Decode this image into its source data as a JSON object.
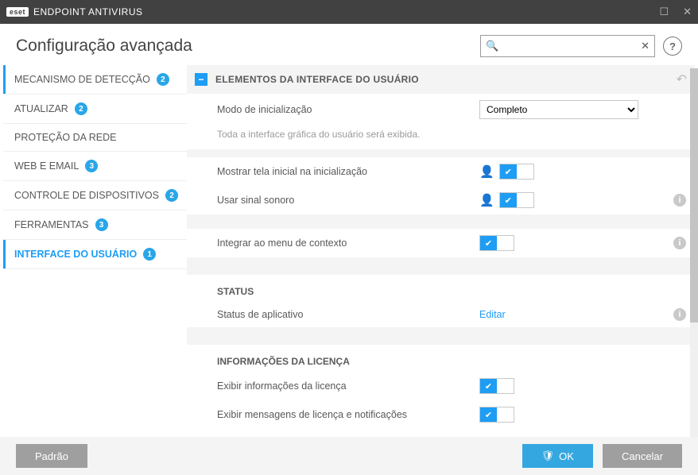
{
  "titlebar": {
    "brand_logo": "eset",
    "brand_text": "ENDPOINT ANTIVIRUS"
  },
  "header": {
    "title": "Configuração avançada",
    "search_placeholder": "",
    "help": "?"
  },
  "sidebar": {
    "items": [
      {
        "label": "MECANISMO DE DETECÇÃO",
        "badge": "2"
      },
      {
        "label": "ATUALIZAR",
        "badge": "2"
      },
      {
        "label": "PROTEÇÃO DA REDE",
        "badge": ""
      },
      {
        "label": "WEB E EMAIL",
        "badge": "3"
      },
      {
        "label": "CONTROLE DE DISPOSITIVOS",
        "badge": "2"
      },
      {
        "label": "FERRAMENTAS",
        "badge": "3"
      },
      {
        "label": "INTERFACE DO USUÁRIO",
        "badge": "1"
      }
    ]
  },
  "content": {
    "section_title": "ELEMENTOS DA INTERFACE DO USUÁRIO",
    "startup_mode_label": "Modo de inicialização",
    "startup_mode_value": "Completo",
    "startup_mode_hint": "Toda a interface gráfica do usuário será exibida.",
    "show_splash_label": "Mostrar tela inicial na inicialização",
    "use_sound_label": "Usar sinal sonoro",
    "context_menu_label": "Integrar ao menu de contexto",
    "status_head": "STATUS",
    "status_app_label": "Status de aplicativo",
    "status_app_action": "Editar",
    "license_head": "INFORMAÇÕES DA LICENÇA",
    "license_show_label": "Exibir informações da licença",
    "license_msg_label": "Exibir mensagens de licença e notificações"
  },
  "footer": {
    "default": "Padrão",
    "ok": "OK",
    "cancel": "Cancelar"
  }
}
